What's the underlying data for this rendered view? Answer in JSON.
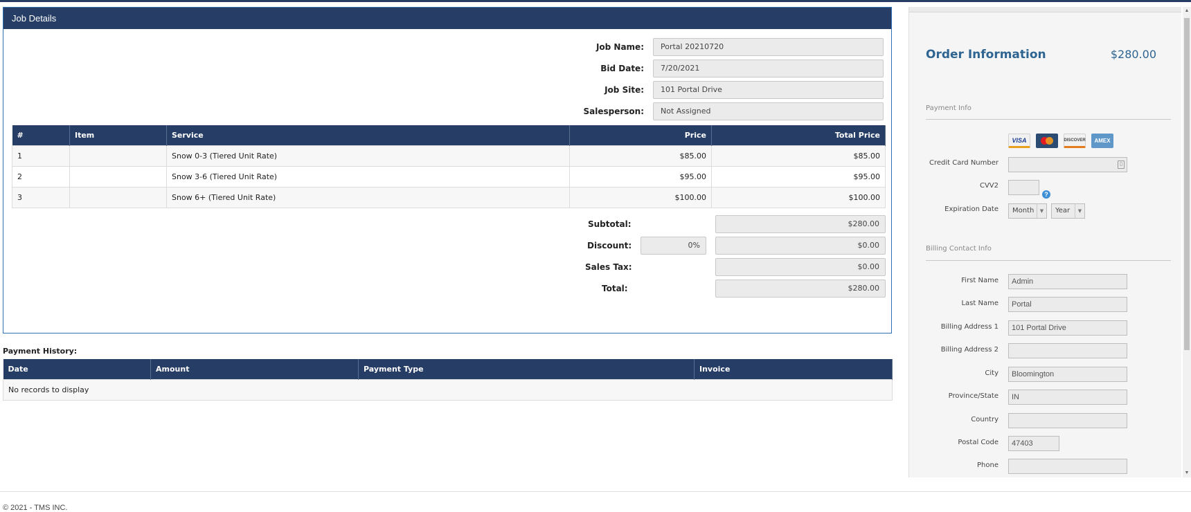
{
  "job": {
    "header": "Job Details",
    "fields": [
      {
        "label": "Job Name:",
        "value": "Portal 20210720"
      },
      {
        "label": "Bid Date:",
        "value": "7/20/2021"
      },
      {
        "label": "Job Site:",
        "value": "101 Portal Drive"
      },
      {
        "label": "Salesperson:",
        "value": "Not Assigned"
      }
    ],
    "items_table": {
      "columns": [
        "#",
        "Item",
        "Service",
        "Price",
        "Total Price"
      ],
      "rows": [
        {
          "num": "1",
          "item": "",
          "service": "Snow 0-3 (Tiered Unit Rate)",
          "price": "$85.00",
          "total": "$85.00"
        },
        {
          "num": "2",
          "item": "",
          "service": "Snow 3-6 (Tiered Unit Rate)",
          "price": "$95.00",
          "total": "$95.00"
        },
        {
          "num": "3",
          "item": "",
          "service": "Snow 6+ (Tiered Unit Rate)",
          "price": "$100.00",
          "total": "$100.00"
        }
      ]
    },
    "totals": {
      "subtotal_label": "Subtotal:",
      "subtotal": "$280.00",
      "discount_label": "Discount:",
      "discount_pct": "0%",
      "discount": "$0.00",
      "tax_label": "Sales Tax:",
      "tax": "$0.00",
      "total_label": "Total:",
      "total": "$280.00"
    }
  },
  "payment_history": {
    "label": "Payment History:",
    "columns": [
      "Date",
      "Amount",
      "Payment Type",
      "Invoice"
    ],
    "empty_text": "No records to display"
  },
  "footer": "© 2021 - TMS INC.",
  "order": {
    "title": "Order Information",
    "total": "$280.00",
    "payment_section": "Payment Info",
    "cards": [
      "VISA",
      "MasterCard",
      "DISCOVER",
      "AMEX"
    ],
    "credit_card_label": "Credit Card Number",
    "credit_card_value": "",
    "cvv_label": "CVV2",
    "cvv_value": "",
    "expiration_label": "Expiration Date",
    "month_placeholder": "Month",
    "year_placeholder": "Year",
    "billing_section": "Billing Contact Info",
    "billing_fields": [
      {
        "label": "First Name",
        "value": "Admin"
      },
      {
        "label": "Last Name",
        "value": "Portal"
      },
      {
        "label": "Billing Address 1",
        "value": "101 Portal Drive"
      },
      {
        "label": "Billing Address 2",
        "value": ""
      },
      {
        "label": "City",
        "value": "Bloomington"
      },
      {
        "label": "Province/State",
        "value": "IN"
      },
      {
        "label": "Country",
        "value": ""
      },
      {
        "label": "Postal Code",
        "value": "47403"
      },
      {
        "label": "Phone",
        "value": ""
      }
    ]
  },
  "colors": {
    "header_bg": "#263d66",
    "accent": "#2e6491",
    "border_blue": "#2e6fb5"
  }
}
